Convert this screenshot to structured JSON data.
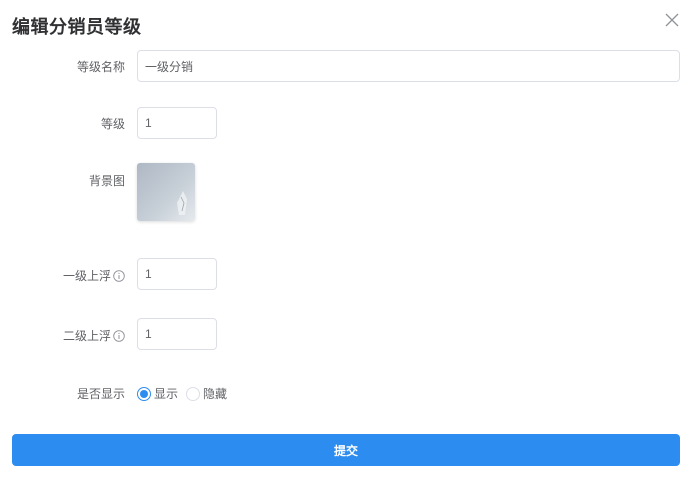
{
  "dialog": {
    "title": "编辑分销员等级",
    "close_icon": "close-icon"
  },
  "form": {
    "level_name": {
      "label": "等级名称",
      "value": "一级分销"
    },
    "level": {
      "label": "等级",
      "value": "1"
    },
    "background": {
      "label": "背景图",
      "image": "background-thumbnail"
    },
    "first_float": {
      "label": "一级上浮",
      "value": "1",
      "icon": "info-icon"
    },
    "second_float": {
      "label": "二级上浮",
      "value": "1",
      "icon": "info-icon"
    },
    "visibility": {
      "label": "是否显示",
      "options": [
        {
          "label": "显示",
          "checked": true
        },
        {
          "label": "隐藏",
          "checked": false
        }
      ]
    }
  },
  "submit_label": "提交",
  "colors": {
    "primary": "#2d8cf0",
    "border": "#dcdfe6",
    "label": "#606266"
  }
}
